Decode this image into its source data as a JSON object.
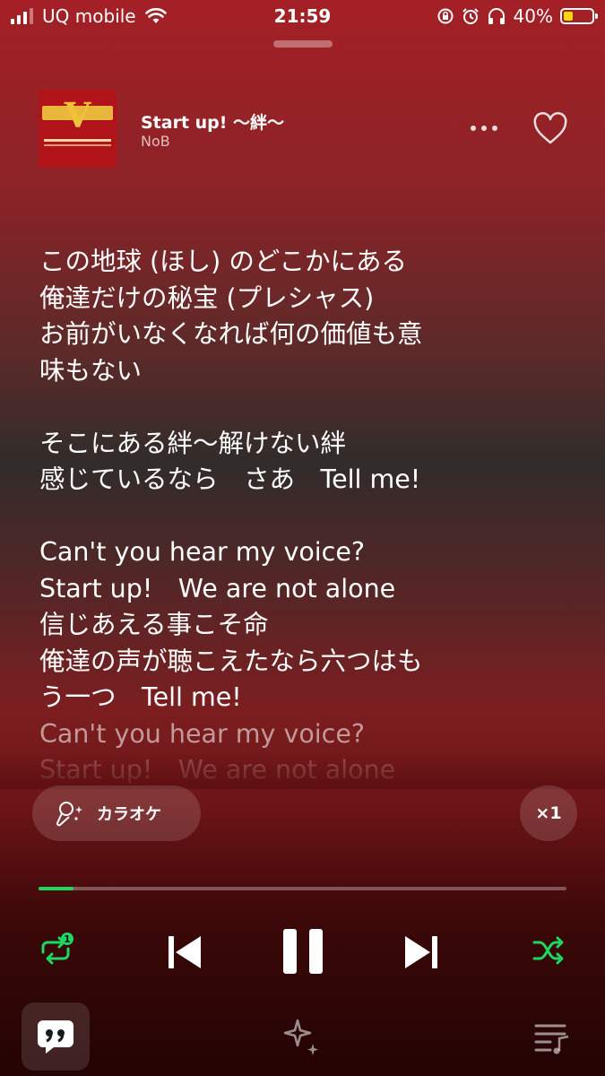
{
  "status_bar": {
    "carrier": "UQ mobile",
    "time": "21:59",
    "battery_percent": "40%"
  },
  "now_playing": {
    "title": "Start up! 〜絆〜",
    "artist": "NoB",
    "liked": false
  },
  "lyrics": {
    "lines": [
      {
        "text": "この地球 (ほし) のどこかにある",
        "state": "active"
      },
      {
        "text": "俺達だけの秘宝 (プレシャス)",
        "state": "active"
      },
      {
        "text": "お前がいなくなれば何の価値も意",
        "state": "active"
      },
      {
        "text": "味もない",
        "state": "active"
      },
      {
        "text": "",
        "state": "blank"
      },
      {
        "text": "そこにある絆〜解けない絆",
        "state": "active"
      },
      {
        "text": "感じているなら　さあ　Tell me!",
        "state": "active"
      },
      {
        "text": "",
        "state": "blank"
      },
      {
        "text": "Can't you hear my voice?",
        "state": "active"
      },
      {
        "text": "Start up!　We are not alone",
        "state": "active"
      },
      {
        "text": "信じあえる事こそ命",
        "state": "active"
      },
      {
        "text": "俺達の声が聴こえたなら六つはも",
        "state": "active"
      },
      {
        "text": "う一つ　Tell me!",
        "state": "active"
      },
      {
        "text": "Can't you hear my voice?",
        "state": "dim"
      },
      {
        "text": "Start up!　We are not alone",
        "state": "faded"
      }
    ]
  },
  "controls": {
    "karaoke_label": "カラオケ",
    "speed_label": "×1",
    "progress_fraction": 0.066,
    "repeat_badge": "1",
    "accent_color": "#1ed760"
  }
}
